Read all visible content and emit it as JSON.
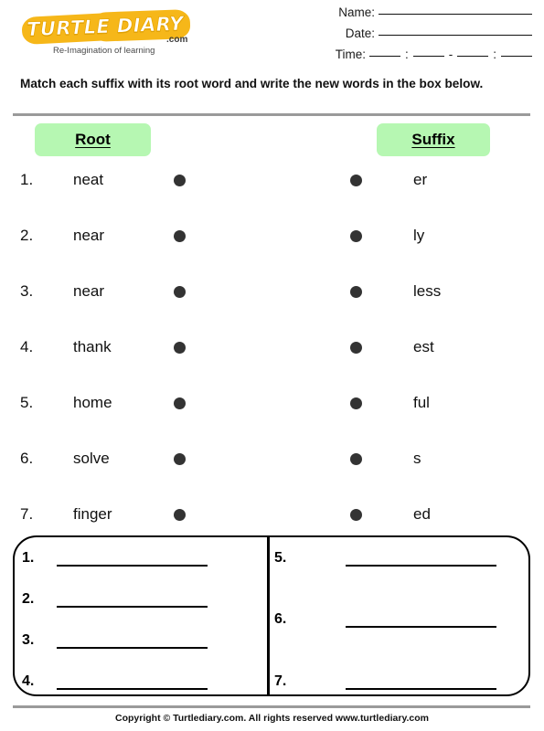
{
  "header": {
    "logo": {
      "wordmark": "TURTLE DIARY",
      "dotcom": ".com",
      "tagline": "Re-Imagination of learning",
      "brand_color": "#f6b719"
    },
    "fields": [
      {
        "label": "Name:",
        "value": "",
        "type": "long"
      },
      {
        "label": "Date:",
        "value": "",
        "type": "long"
      },
      {
        "label": "Time:",
        "value": "",
        "type": "time",
        "separators": [
          ":",
          "-",
          ":"
        ]
      }
    ]
  },
  "instruction": "Match each suffix with its root word and write the new words in the box below.",
  "columns": {
    "root_header": "Root",
    "suffix_header": "Suffix",
    "header_bg": "#b6f7b2",
    "dot_color": "#333333"
  },
  "match_rows": [
    {
      "number": "1.",
      "root": "neat",
      "suffix": "er"
    },
    {
      "number": "2.",
      "root": "near",
      "suffix": "ly"
    },
    {
      "number": "3.",
      "root": "near",
      "suffix": "less"
    },
    {
      "number": "4.",
      "root": "thank",
      "suffix": "est"
    },
    {
      "number": "5.",
      "root": "home",
      "suffix": "ful"
    },
    {
      "number": "6.",
      "root": "solve",
      "suffix": "s"
    },
    {
      "number": "7.",
      "root": "finger",
      "suffix": "ed"
    }
  ],
  "answer_box": {
    "left_items": [
      {
        "number": "1.",
        "value": ""
      },
      {
        "number": "2.",
        "value": ""
      },
      {
        "number": "3.",
        "value": ""
      },
      {
        "number": "4.",
        "value": ""
      }
    ],
    "right_items": [
      {
        "number": "5.",
        "value": ""
      },
      {
        "number": "6.",
        "value": ""
      },
      {
        "number": "7.",
        "value": ""
      }
    ]
  },
  "footer": "Copyright © Turtlediary.com. All rights reserved  www.turtlediary.com"
}
